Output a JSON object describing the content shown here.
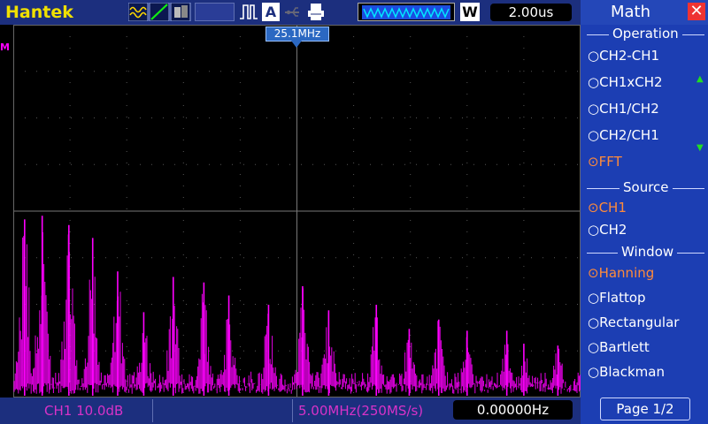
{
  "header": {
    "brand": "Hantek",
    "trigger_mode_label": "A",
    "run_mode_label": "W",
    "timebase": "2.00us",
    "center_freq_marker": "25.1MHz"
  },
  "status": {
    "channel_scale": "CH1 10.0dB",
    "freq_scale": "5.00MHz(250MS/s)",
    "cursor_freq": "0.00000Hz"
  },
  "screen": {
    "marker_label": "M"
  },
  "panel": {
    "title": "Math",
    "operation_label": "Operation",
    "operations": [
      "CH2-CH1",
      "CH1xCH2",
      "CH1/CH2",
      "CH2/CH1",
      "FFT"
    ],
    "selected_operation": "FFT",
    "source_label": "Source",
    "sources": [
      "CH1",
      "CH2"
    ],
    "selected_source": "CH1",
    "window_label": "Window",
    "windows": [
      "Hanning",
      "Flattop",
      "Rectangular",
      "Bartlett",
      "Blackman"
    ],
    "selected_window": "Hanning",
    "page": "Page 1/2"
  },
  "colors": {
    "trace": "#ff00ff",
    "grid": "#888888",
    "panel": "#1c3eb3",
    "accent": "#ff8b3a"
  },
  "spectrum": {
    "peaks": [
      {
        "f": 1.0,
        "h": 0.96
      },
      {
        "f": 2.55,
        "h": 0.98
      },
      {
        "f": 4.9,
        "h": 0.93
      },
      {
        "f": 7.0,
        "h": 0.86
      },
      {
        "f": 9.2,
        "h": 0.68
      },
      {
        "f": 11.5,
        "h": 0.46
      },
      {
        "f": 14.1,
        "h": 0.65
      },
      {
        "f": 16.8,
        "h": 0.62
      },
      {
        "f": 19.0,
        "h": 0.55
      },
      {
        "f": 22.5,
        "h": 0.5
      },
      {
        "f": 25.5,
        "h": 0.6
      },
      {
        "f": 27.8,
        "h": 0.47
      },
      {
        "f": 32.0,
        "h": 0.5
      },
      {
        "f": 34.9,
        "h": 0.37
      },
      {
        "f": 37.5,
        "h": 0.42
      },
      {
        "f": 40.0,
        "h": 0.36
      },
      {
        "f": 43.5,
        "h": 0.36
      },
      {
        "f": 45.0,
        "h": 0.29
      },
      {
        "f": 48.0,
        "h": 0.28
      }
    ]
  }
}
